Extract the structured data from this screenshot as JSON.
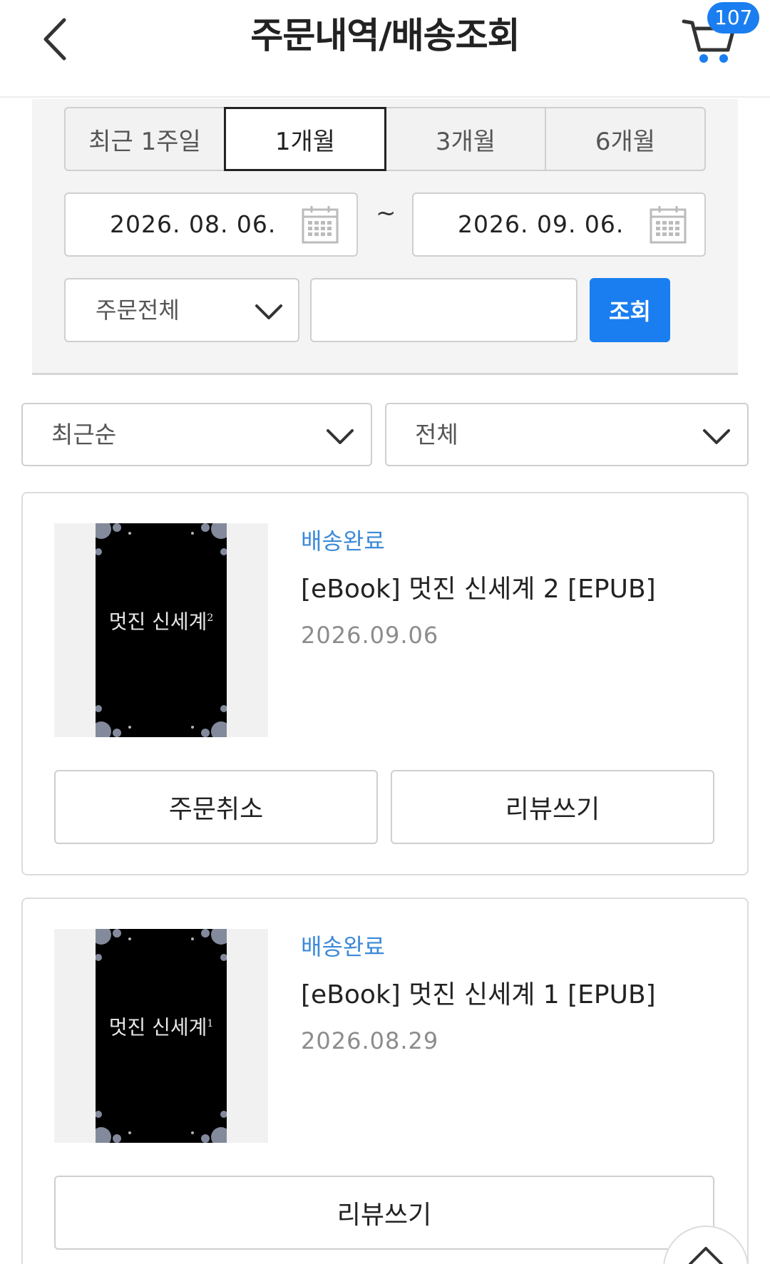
{
  "header": {
    "title": "주문내역/배송조회",
    "cart_count": "107"
  },
  "filter": {
    "period_tabs": [
      {
        "label": "최근 1주일",
        "active": false
      },
      {
        "label": "1개월",
        "active": true
      },
      {
        "label": "3개월",
        "active": false
      },
      {
        "label": "6개월",
        "active": false
      }
    ],
    "start_date": "2026. 08. 06.",
    "end_date": "2026. 09. 06.",
    "range_separator": "~",
    "order_type": "주문전체",
    "search_value": "",
    "search_button": "조회"
  },
  "sort": {
    "order": "최근순",
    "status": "전체"
  },
  "orders": [
    {
      "status": "배송완료",
      "title": "[eBook] 멋진 신세계 2 [EPUB]",
      "date": "2026.09.06",
      "cover_title": "멋진 신세계",
      "cover_number": "2",
      "buttons": [
        "주문취소",
        "리뷰쓰기"
      ]
    },
    {
      "status": "배송완료",
      "title": "[eBook] 멋진 신세계 1 [EPUB]",
      "date": "2026.08.29",
      "cover_title": "멋진 신세계",
      "cover_number": "1",
      "buttons": [
        "리뷰쓰기"
      ]
    }
  ],
  "colors": {
    "accent": "#1a7ef0",
    "status": "#3b8ad8",
    "date_text": "#8c8c8c"
  },
  "icons": [
    "back-icon",
    "cart-icon",
    "calendar-icon",
    "chevron-down-icon",
    "scroll-top-icon"
  ]
}
